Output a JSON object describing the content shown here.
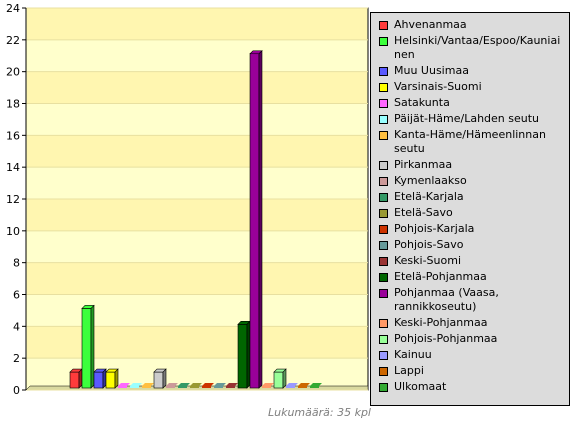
{
  "chart_data": {
    "type": "bar",
    "ylim": [
      0,
      24
    ],
    "yticks": [
      0,
      2,
      4,
      6,
      8,
      10,
      12,
      14,
      16,
      18,
      20,
      22,
      24
    ],
    "grid": "horizontal",
    "legend_position": "right",
    "series": [
      {
        "name": "Ahvenanmaa",
        "value": 1,
        "color": "#ff3b3b"
      },
      {
        "name": "Helsinki/Vantaa/Espoo/Kauniainen",
        "value": 5,
        "color": "#3cff3c"
      },
      {
        "name": "Muu Uusimaa",
        "value": 1,
        "color": "#5a5aff"
      },
      {
        "name": "Varsinais-Suomi",
        "value": 1,
        "color": "#ffff00"
      },
      {
        "name": "Satakunta",
        "value": 0,
        "color": "#ff66ff"
      },
      {
        "name": "Päijät-Häme/Lahden seutu",
        "value": 0,
        "color": "#99ffff"
      },
      {
        "name": "Kanta-Häme/Hämeenlinnan seutu",
        "value": 0,
        "color": "#ffbf40"
      },
      {
        "name": "Pirkanmaa",
        "value": 1,
        "color": "#cccccc"
      },
      {
        "name": "Kymenlaakso",
        "value": 0,
        "color": "#cc9999"
      },
      {
        "name": "Etelä-Karjala",
        "value": 0,
        "color": "#339966"
      },
      {
        "name": "Etelä-Savo",
        "value": 0,
        "color": "#999933"
      },
      {
        "name": "Pohjois-Karjala",
        "value": 0,
        "color": "#cc3300"
      },
      {
        "name": "Pohjois-Savo",
        "value": 0,
        "color": "#669999"
      },
      {
        "name": "Keski-Suomi",
        "value": 0,
        "color": "#993333"
      },
      {
        "name": "Etelä-Pohjanmaa",
        "value": 4,
        "color": "#006600"
      },
      {
        "name": "Pohjanmaa (Vaasa, rannikkoseutu)",
        "value": 21,
        "color": "#990099"
      },
      {
        "name": "Keski-Pohjanmaa",
        "value": 0,
        "color": "#ff9966"
      },
      {
        "name": "Pohjois-Pohjanmaa",
        "value": 1,
        "color": "#99ff99"
      },
      {
        "name": "Kainuu",
        "value": 0,
        "color": "#9999ff"
      },
      {
        "name": "Lappi",
        "value": 0,
        "color": "#cc6600"
      },
      {
        "name": "Ulkomaat",
        "value": 0,
        "color": "#33aa33"
      }
    ]
  },
  "footer": {
    "total_label": "Lukumäärä: 35 kpl"
  }
}
